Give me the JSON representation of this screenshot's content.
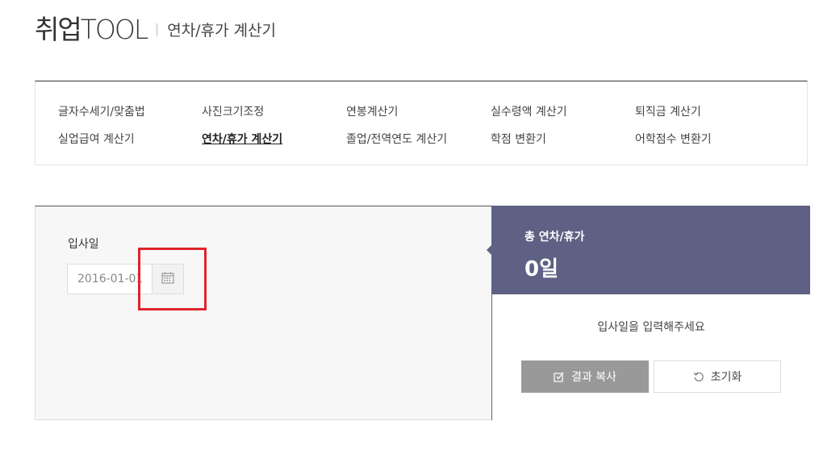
{
  "header": {
    "brand": "취업TOOL",
    "page_title": "연차/휴가 계산기"
  },
  "nav": {
    "items": [
      {
        "label": "글자수세기/맞춤법",
        "active": false
      },
      {
        "label": "사진크기조정",
        "active": false
      },
      {
        "label": "연봉계산기",
        "active": false
      },
      {
        "label": "실수령액 계산기",
        "active": false
      },
      {
        "label": "퇴직금 계산기",
        "active": false
      },
      {
        "label": "실업급여 계산기",
        "active": false
      },
      {
        "label": "연차/휴가 계산기",
        "active": true
      },
      {
        "label": "졸업/전역연도 계산기",
        "active": false
      },
      {
        "label": "학점 변환기",
        "active": false
      },
      {
        "label": "어학점수 변환기",
        "active": false
      }
    ]
  },
  "form": {
    "hire_date_label": "입사일",
    "hire_date_value": "2016-01-01",
    "calendar_icon": "calendar-icon"
  },
  "result": {
    "label": "총 연차/휴가",
    "value": "0일",
    "message": "입사일을 입력해주세요",
    "copy_button": "결과 복사",
    "reset_button": "초기화"
  },
  "colors": {
    "accent": "#5e6183",
    "highlight": "#e0242b",
    "copy_button_bg": "#999999"
  }
}
